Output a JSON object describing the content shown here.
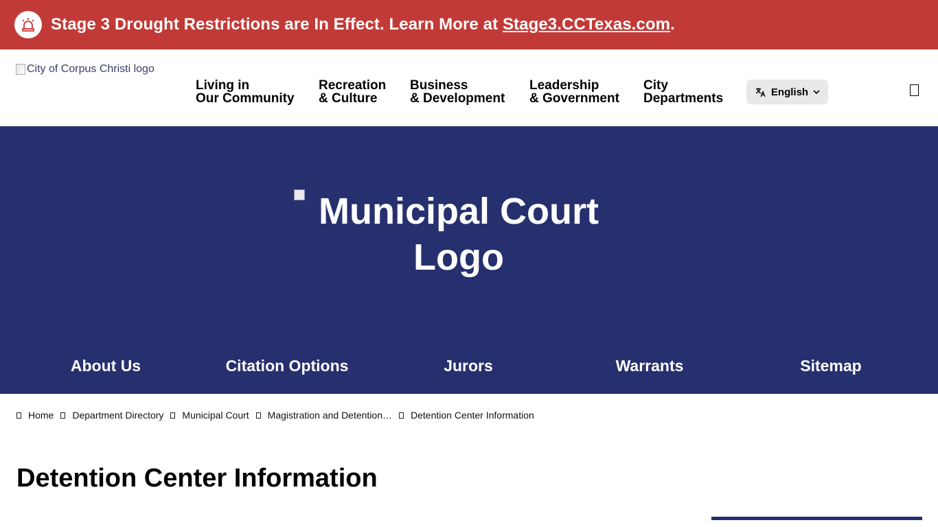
{
  "alert": {
    "text": "Stage 3 Drought Restrictions are In Effect. Learn More at ",
    "link": "Stage3.CCTexas.com",
    "suffix": ".",
    "icon": "siren-icon",
    "color": "#c23a37"
  },
  "header": {
    "logo_alt": "City of Corpus Christi logo",
    "nav": [
      {
        "line1": "Living in",
        "line2": "Our Community"
      },
      {
        "line1": "Recreation",
        "line2": "& Culture"
      },
      {
        "line1": "Business",
        "line2": "& Development"
      },
      {
        "line1": "Leadership",
        "line2": "& Government"
      },
      {
        "line1": "City",
        "line2": "Departments"
      }
    ],
    "language": "English",
    "language_icon": "translate-icon",
    "search_icon": "search-icon"
  },
  "hero": {
    "logo_alt_line1": "Municipal Court",
    "logo_alt_line2": "Logo",
    "color": "#26306e",
    "subnav": [
      "About Us",
      "Citation Options",
      "Jurors",
      "Warrants",
      "Sitemap"
    ]
  },
  "breadcrumb": [
    "Home",
    "Department Directory",
    "Municipal Court",
    "Magistration and Detention…",
    "Detention Center Information"
  ],
  "page": {
    "title": "Detention Center Information"
  }
}
